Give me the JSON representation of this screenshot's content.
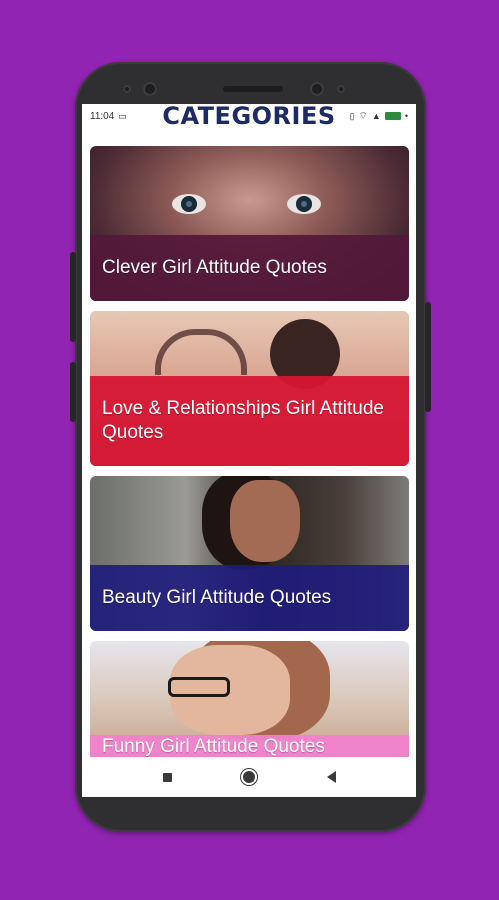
{
  "status": {
    "time": "11:04",
    "battery_level": "full"
  },
  "header": {
    "title": "CATEGORIES"
  },
  "categories": [
    {
      "label": "Clever Girl Attitude Quotes",
      "color": "#54183a"
    },
    {
      "label": "Love & Relationships Girl Attitude Quotes",
      "color": "#d61634"
    },
    {
      "label": "Beauty Girl Attitude Quotes",
      "color": "#201c7d"
    },
    {
      "label": "Funny Girl Attitude Quotes",
      "color": "#f082cd"
    }
  ],
  "colors": {
    "background": "#9224b4",
    "title": "#1c2a66"
  },
  "icons": {
    "status": [
      "sim-icon",
      "wifi-icon",
      "signal-icon",
      "battery-icon"
    ],
    "nav": [
      "recents-icon",
      "home-icon",
      "back-icon"
    ]
  }
}
